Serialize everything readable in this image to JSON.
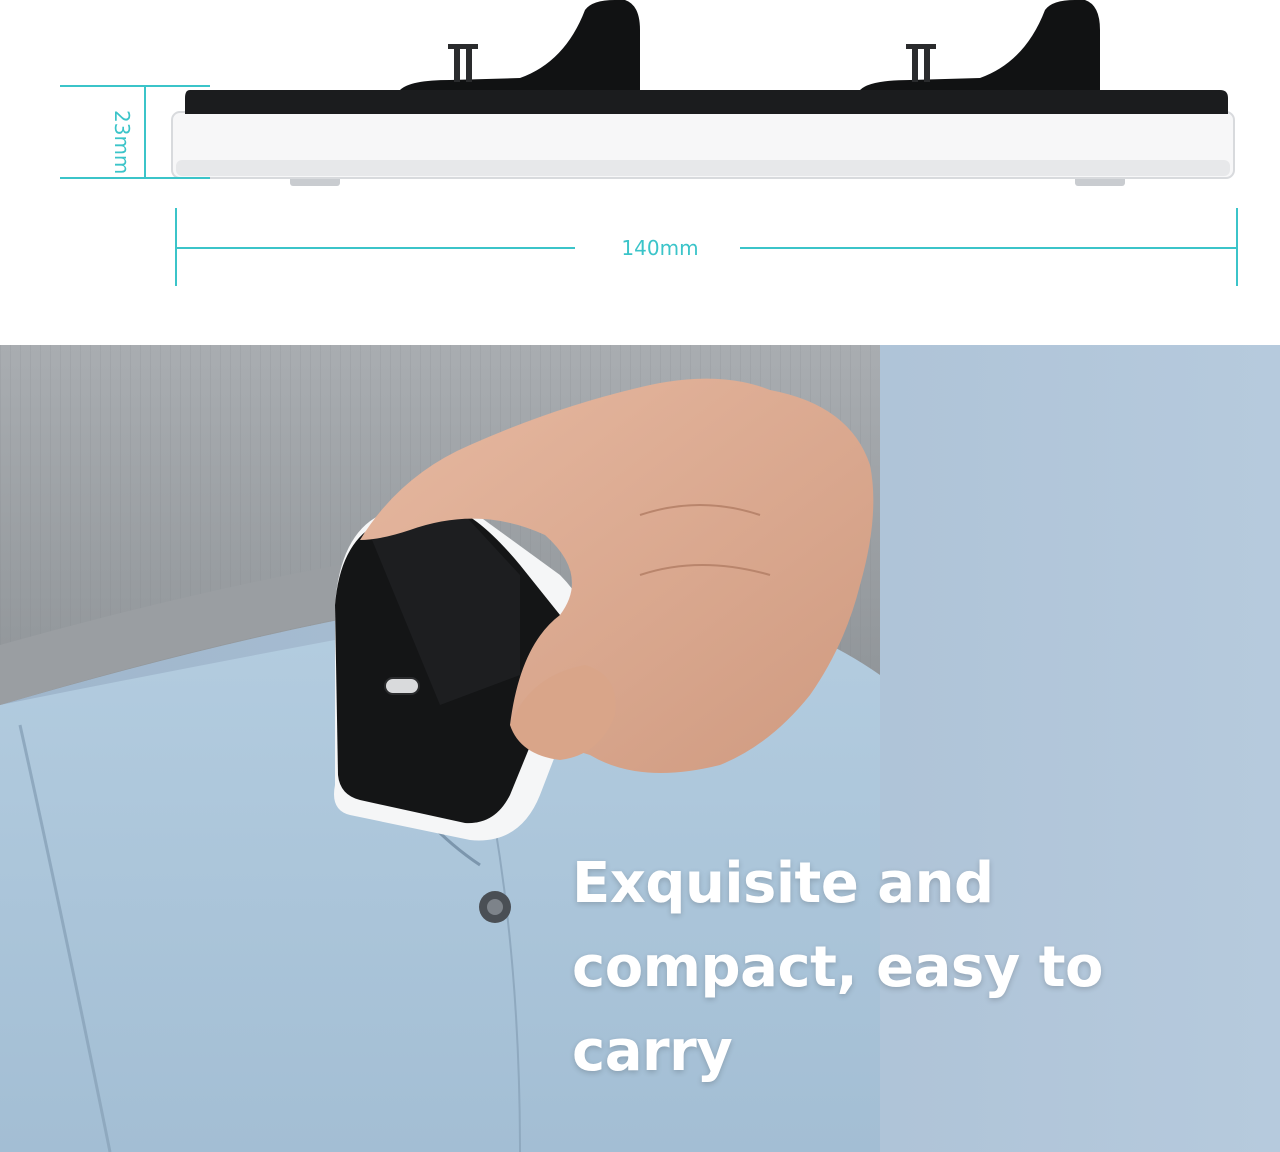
{
  "dimensions": {
    "height_label": "23mm",
    "width_label": "140mm",
    "accent_color": "#3bc4c9"
  },
  "headline": {
    "line1": "Exquisite and",
    "line2": "compact, easy to carry"
  }
}
